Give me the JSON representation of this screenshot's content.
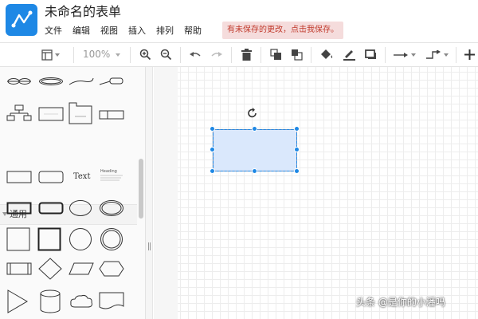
{
  "app": {
    "document_title": "未命名的表单",
    "menu": [
      "文件",
      "编辑",
      "视图",
      "插入",
      "排列",
      "帮助"
    ],
    "unsaved_notice": "有未保存的更改，点击我保存。",
    "brand_color": "#1e88e5"
  },
  "toolbar": {
    "zoom": "100%",
    "icons": [
      "page-view-icon",
      "zoom-in-icon",
      "zoom-out-icon",
      "undo-icon",
      "redo-icon",
      "delete-icon",
      "to-front-icon",
      "to-back-icon",
      "fill-color-icon",
      "line-color-icon",
      "shadow-icon",
      "connection-icon",
      "waypoints-icon",
      "insert-icon"
    ]
  },
  "sidebar": {
    "section_general": "通用",
    "text_shape_label": "Text",
    "heading_label": "Heading"
  },
  "watermark": "头条 @是你的小潘吗"
}
